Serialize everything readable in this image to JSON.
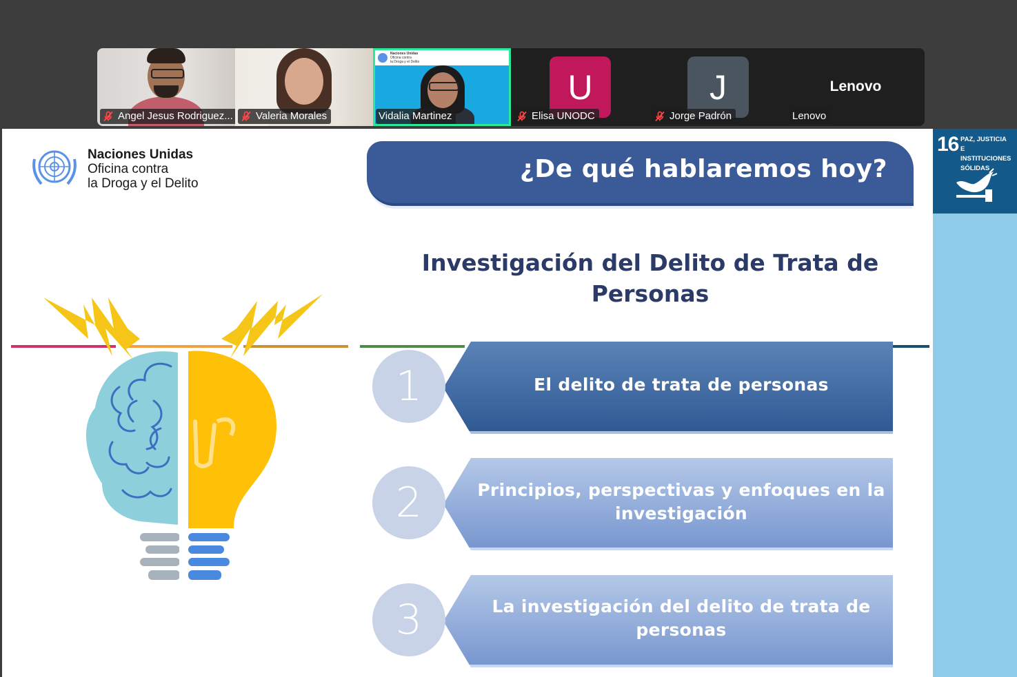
{
  "participants": [
    {
      "name": "Angel Jesus Rodriguez...",
      "muted": true,
      "type": "video"
    },
    {
      "name": "Valeria Morales",
      "muted": true,
      "type": "video"
    },
    {
      "name": "Vidalia Martinez",
      "muted": false,
      "type": "video",
      "active_speaker": true
    },
    {
      "name": "Elisa UNODC",
      "muted": true,
      "type": "avatar",
      "initial": "U",
      "color": "#c0185a"
    },
    {
      "name": "Jorge Padrón",
      "muted": true,
      "type": "avatar",
      "initial": "J",
      "color": "#4a5560"
    },
    {
      "name": "Lenovo",
      "muted": false,
      "type": "text",
      "display": "Lenovo"
    }
  ],
  "vidalia_mini_logo": [
    "Naciones Unidas",
    "Oficina contra",
    "la Droga y el Delito"
  ],
  "slide": {
    "logo_lines": [
      "Naciones Unidas",
      "Oficina contra",
      "la Droga y el Delito"
    ],
    "header": "¿De qué hablaremos hoy?",
    "title_line1": "Investigación del Delito de Trata de",
    "title_line2": "Personas",
    "steps": [
      {
        "number": "1",
        "line1": "El delito de trata de personas",
        "line2": ""
      },
      {
        "number": "2",
        "line1": "Principios, perspectivas y enfoques en la",
        "line2": "investigación"
      },
      {
        "number": "3",
        "line1": "La investigación del delito de trata de",
        "line2": "personas"
      }
    ],
    "band_colors": [
      "#d0336a",
      "#f0a040",
      "#c8923a",
      "#4e8a4a",
      "#3b9ad4",
      "#5cb85c",
      "#1f5d8a",
      "#1a4e6e"
    ]
  },
  "sdg": {
    "number": "16",
    "lines": [
      "PAZ, JUSTICIA",
      "E INSTITUCIONES",
      "SÓLIDAS"
    ]
  },
  "colors": {
    "header_bar": "#3a5a98",
    "title": "#2b3a67",
    "step1_top": "#5b83b8",
    "step1_bottom": "#2f5a93",
    "step_light_top": "#b4c8e8",
    "step_light_bottom": "#7897cf",
    "active_border": "#2ee89a"
  }
}
